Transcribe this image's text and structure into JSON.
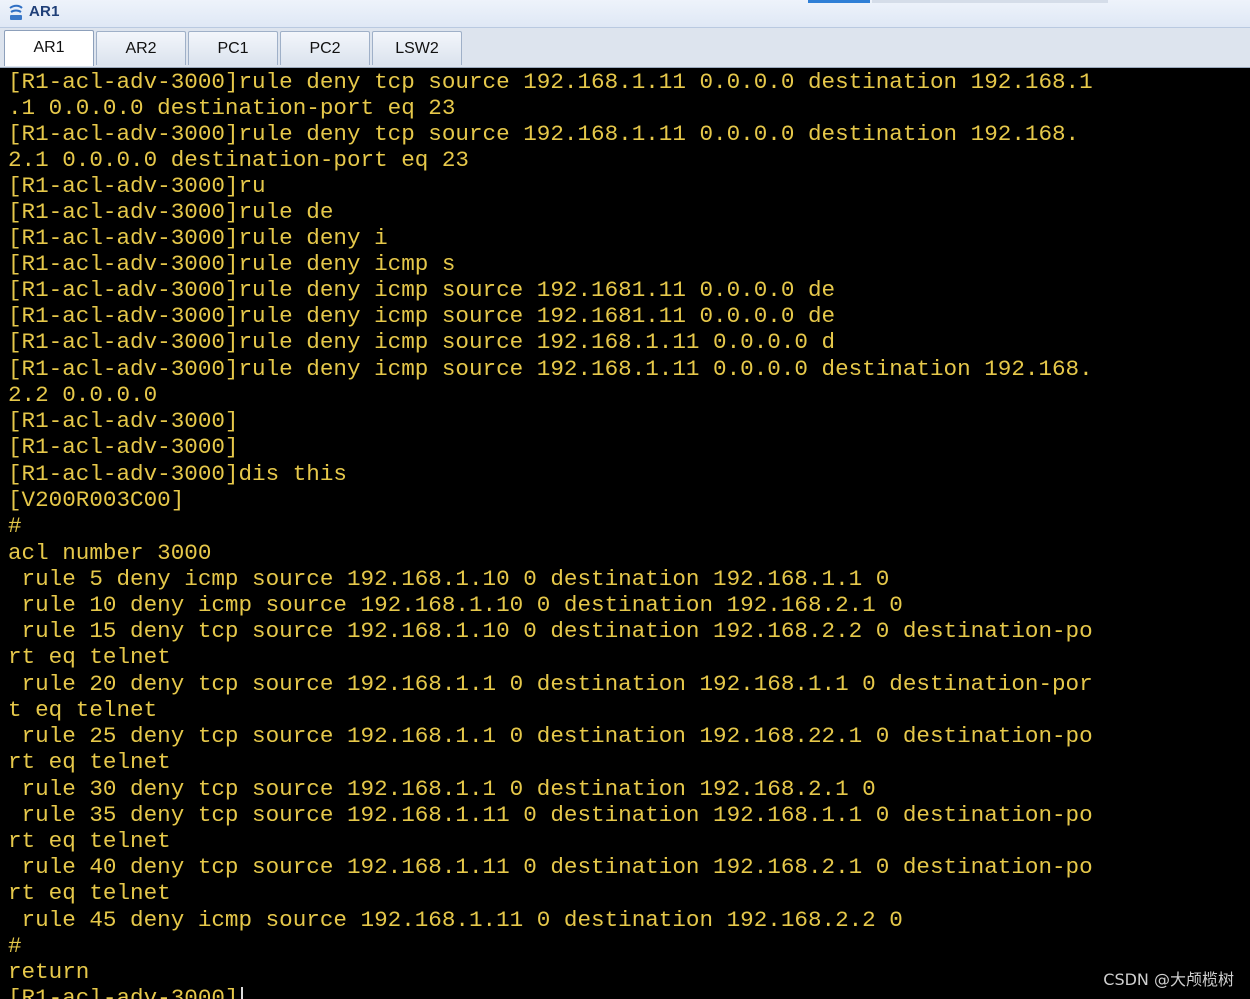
{
  "window": {
    "title": "AR1",
    "icon": "ensp-device-icon"
  },
  "tabs": [
    {
      "label": "AR1",
      "active": true
    },
    {
      "label": "AR2",
      "active": false
    },
    {
      "label": "PC1",
      "active": false
    },
    {
      "label": "PC2",
      "active": false
    },
    {
      "label": "LSW2",
      "active": false
    }
  ],
  "terminal": {
    "text_color": "#e6c84a",
    "background": "#000000",
    "lines": [
      "[R1-acl-adv-3000]rule deny tcp source 192.168.1.11 0.0.0.0 destination 192.168.1",
      ".1 0.0.0.0 destination-port eq 23",
      "[R1-acl-adv-3000]rule deny tcp source 192.168.1.11 0.0.0.0 destination 192.168.",
      "2.1 0.0.0.0 destination-port eq 23",
      "[R1-acl-adv-3000]ru",
      "[R1-acl-adv-3000]rule de",
      "[R1-acl-adv-3000]rule deny i",
      "[R1-acl-adv-3000]rule deny icmp s",
      "[R1-acl-adv-3000]rule deny icmp source 192.1681.11 0.0.0.0 de",
      "[R1-acl-adv-3000]rule deny icmp source 192.1681.11 0.0.0.0 de",
      "[R1-acl-adv-3000]rule deny icmp source 192.168.1.11 0.0.0.0 d",
      "[R1-acl-adv-3000]rule deny icmp source 192.168.1.11 0.0.0.0 destination 192.168.",
      "2.2 0.0.0.0",
      "[R1-acl-adv-3000]",
      "[R1-acl-adv-3000]",
      "[R1-acl-adv-3000]dis this",
      "[V200R003C00]",
      "#",
      "acl number 3000",
      " rule 5 deny icmp source 192.168.1.10 0 destination 192.168.1.1 0",
      " rule 10 deny icmp source 192.168.1.10 0 destination 192.168.2.1 0",
      " rule 15 deny tcp source 192.168.1.10 0 destination 192.168.2.2 0 destination-po",
      "rt eq telnet",
      " rule 20 deny tcp source 192.168.1.1 0 destination 192.168.1.1 0 destination-por",
      "t eq telnet",
      " rule 25 deny tcp source 192.168.1.1 0 destination 192.168.22.1 0 destination-po",
      "rt eq telnet",
      " rule 30 deny tcp source 192.168.1.1 0 destination 192.168.2.1 0",
      " rule 35 deny tcp source 192.168.1.11 0 destination 192.168.1.1 0 destination-po",
      "rt eq telnet",
      " rule 40 deny tcp source 192.168.1.11 0 destination 192.168.2.1 0 destination-po",
      "rt eq telnet",
      " rule 45 deny icmp source 192.168.1.11 0 destination 192.168.2.2 0",
      "#",
      "return",
      "[R1-acl-adv-3000]"
    ]
  },
  "watermark": "CSDN @大颅榄树"
}
